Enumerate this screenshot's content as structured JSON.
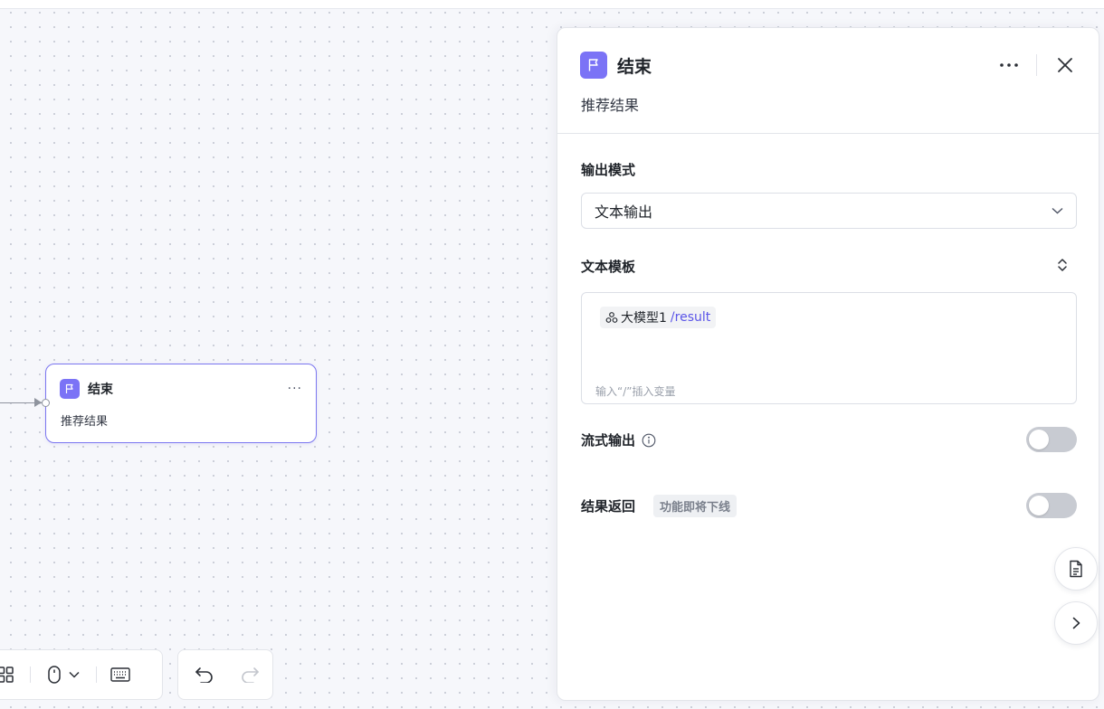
{
  "canvas": {
    "node": {
      "title": "结束",
      "description": "推荐结果",
      "more_label": "···",
      "icon": "flag-icon"
    },
    "toolbar": {
      "left_icons": [
        "layout-grid-icon",
        "mouse-icon",
        "chevron-down-icon",
        "keyboard-icon"
      ],
      "right_icons": [
        "undo-icon",
        "redo-icon"
      ]
    }
  },
  "panel": {
    "title": "结束",
    "description": "推荐结果",
    "icons": [
      "flag-icon",
      "more-icon",
      "close-icon"
    ],
    "output_mode": {
      "label": "输出模式",
      "value": "文本输出"
    },
    "text_template": {
      "label": "文本模板",
      "variable_node": "大模型1",
      "variable_path": "/result",
      "hint": "输入“/”插入变量"
    },
    "stream_output": {
      "label": "流式输出",
      "enabled": false
    },
    "result_return": {
      "label": "结果返回",
      "badge": "功能即将下线",
      "enabled": false
    },
    "float_buttons": [
      "document-icon",
      "chevron-right-icon"
    ]
  },
  "colors": {
    "accent": "#7b73f6",
    "variable_path": "#5b55e8",
    "node_border": "#7b76f0",
    "toggle_off": "#c8cbd2"
  }
}
